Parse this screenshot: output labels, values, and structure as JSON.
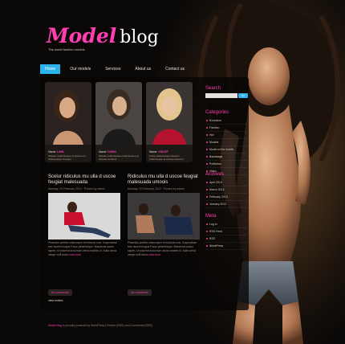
{
  "logo": {
    "part1": "Model",
    "part2": "blog",
    "tagline": "The world fashion models"
  },
  "nav": [
    {
      "label": "Home"
    },
    {
      "label": "Our models"
    },
    {
      "label": "Services"
    },
    {
      "label": "About us"
    },
    {
      "label": "Contact us"
    }
  ],
  "models": [
    {
      "name_prefix": "Name:",
      "name": "LINN",
      "desc": "Aliquam pellentesque id posuere et Pellentesque Suscipit"
    },
    {
      "name_prefix": "Name:",
      "name": "DONN",
      "desc": "Aliquam pellentesque pellentesque at Aenean tincidunt"
    },
    {
      "name_prefix": "Name:",
      "name": "VIOLET",
      "desc": "Fusce pellentesque Aliquam pellentesque at Aenean Suscipit"
    }
  ],
  "posts": [
    {
      "title": "Scelur ridiculus mu ulla d uscoe feugiat malesuada",
      "meta": "Monday, 20 February 2012 · Posted by admin",
      "text": "Phasellus porttitor ullamcorper et ridiculus mus. Suspendisse sem laoreet magna Fusce pellentesque. Maecenas auctor sapien. Ut placerat accumsan varius sodales ut. Nulla varius integer velit lectus",
      "more": "read more",
      "comments": "No comments"
    },
    {
      "title": "Ridiculus mu ulla d uscoe feugiat malesuada umoois",
      "meta": "Monday, 20 February 2012 · Posted by admin",
      "text": "Phasellus porttitor ullamcorper et ridiculus mus. Suspendisse sem laoreet magna Fusce pellentesque. Maecenas auctor sapien. Ut placerat accumsan varius sodales ut. Nulla varius integer velit lectus",
      "more": "read more",
      "comments": "No comments"
    }
  ],
  "view_all": "view entries",
  "sidebar": {
    "search_title": "Search",
    "search_button": "Go",
    "categories_title": "Categories",
    "categories": [
      "Exclusive",
      "Fashion",
      "Hot",
      "Models",
      "Model of the month",
      "Backstage",
      "Portfolios",
      "Video"
    ],
    "archives_title": "Archives",
    "archives": [
      "April 2013",
      "March 2013",
      "February 2013",
      "January 2013"
    ],
    "meta_title": "Meta",
    "meta": [
      "Log in",
      "RSS Feed",
      "RSS",
      "WordPress"
    ]
  },
  "footer": {
    "brand": "Model blog",
    "text": "is proudly powered by WordPress | Entries (RSS) and Comments (RSS)"
  },
  "colors": {
    "accent": "#ff3fb1",
    "nav_active": "#2cb3ec"
  }
}
